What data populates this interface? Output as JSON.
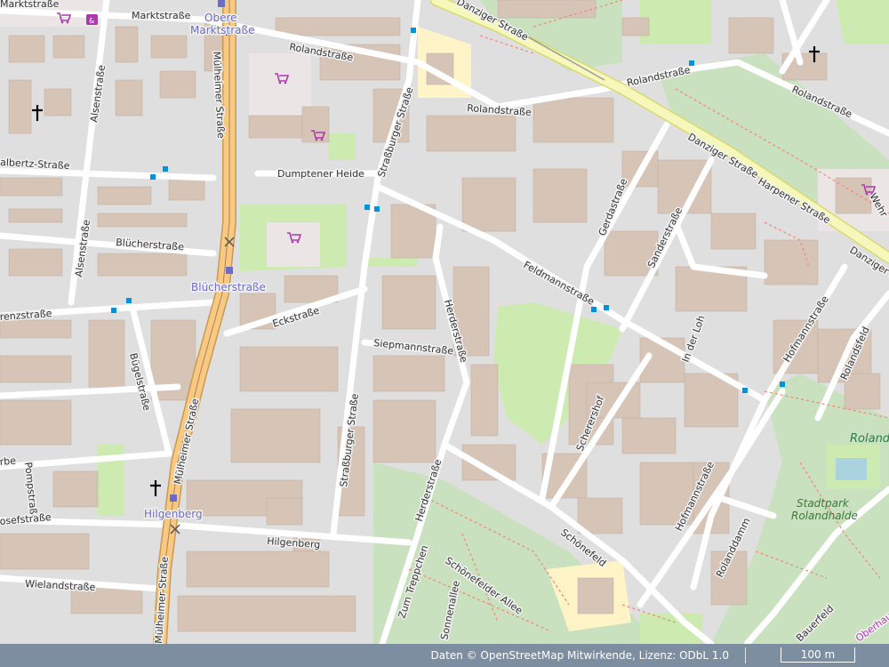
{
  "streets": {
    "marktstrasse_1": "Marktstraße",
    "marktstrasse_2": "Marktstraße",
    "roland_1": "Rolandstraße",
    "roland_2": "Rolandstraße",
    "roland_3": "Rolandstraße",
    "roland_4": "Rolandstraße",
    "danziger_1": "Danziger Straße",
    "danziger_2": "Danziger Straße",
    "danziger_3": "Danziger Straße",
    "alsen_1": "Alsenstraße",
    "alsen_2": "Alsenstraße",
    "albertz": "albertz-Straße",
    "muelheimer_1": "Mülheimer Straße",
    "muelheimer_2": "Mülheimer Straße",
    "muelheimer_3": "Mülheimer Straße",
    "strassburger_1": "Straßburger Straße",
    "strassburger_2": "Straßburger Straße",
    "dumptener": "Dumptener Heide",
    "bluecher": "Blücherstraße",
    "gerda": "Gerdastraße",
    "sander": "Sanderstraße",
    "harpener": "Harpener Straße",
    "wehr": "Wehr",
    "feldmann": "Feldmannstraße",
    "eck": "Eckstraße",
    "herder_1": "Herderstraße",
    "herder_2": "Herderstraße",
    "siepmann": "Siepmannstraße",
    "lorenz": "renzstraße",
    "buegel": "Bügelstraße",
    "in_der_loh": "In der Loh",
    "hofmann_1": "Hofmannstraße",
    "hofmann_2": "Hofmannstraße",
    "rolands": "Rolandsfeld",
    "scherershof": "Scherershof",
    "pomp": "Pompstraße",
    "josef": "osefstraße",
    "erbe": "rbe",
    "hilgenberg": "Hilgenberg",
    "wieland": "Wielandstraße",
    "schoenefeld": "Schönefeld",
    "schoenefelder_allee": "Schönefelder Allee",
    "zum_treppchen": "Zum Treppchen",
    "sonnenallee": "Sonnenallee",
    "landdamm": "Rolanddamm",
    "bauerfeld": "Bauerfeld",
    "oberhausen": "Oberhau"
  },
  "stops": {
    "obere_markt_1": "Obere",
    "obere_markt_2": "Marktstraße",
    "bluecherstrasse": "Blücherstraße",
    "hilgenberg": "Hilgenberg"
  },
  "parks": {
    "stadtpark_1": "Stadtpark",
    "stadtpark_2": "Rolandhalde",
    "roland": "Roland"
  },
  "footer": {
    "attribution": "Daten © OpenStreetMap Mitwirkende, Lizenz: ODbL 1.0",
    "scale_label": "100 m"
  },
  "colors": {
    "background": "#e0dfdf",
    "major_road": "#f8c982",
    "secondary_road": "#f6f8bb",
    "street": "#ffffff",
    "park": "#cdebb0",
    "allotments": "#c9e1bf",
    "building": "#d6c4b7",
    "retail": "#fff3c8",
    "footer": "#7d8ea0"
  }
}
